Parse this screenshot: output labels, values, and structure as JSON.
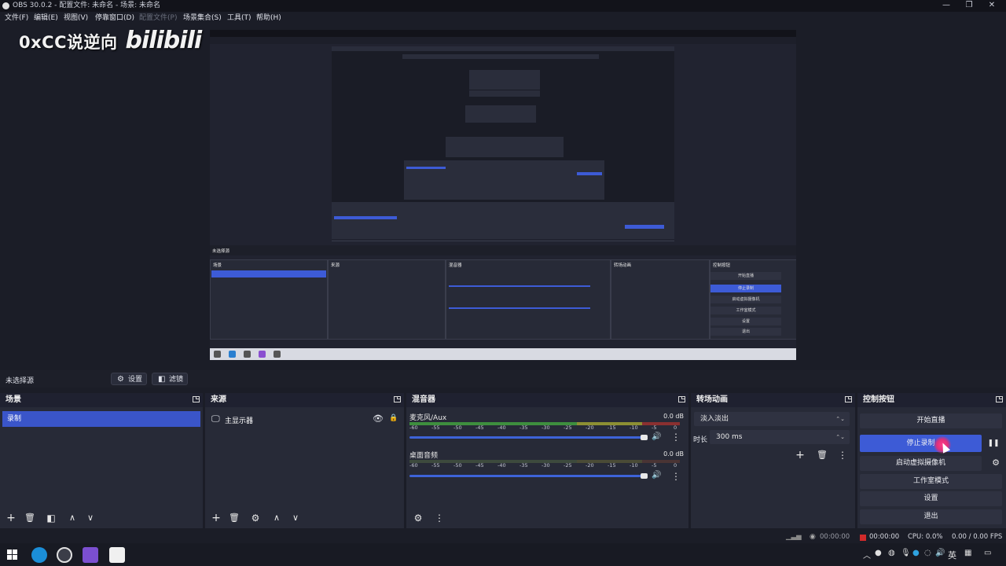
{
  "window": {
    "title": "OBS 30.0.2 - 配置文件: 未命名 - 场景: 未命名",
    "minimize_glyph": "—",
    "maximize_glyph": "❐",
    "close_glyph": "✕"
  },
  "menu": [
    "文件(F)",
    "编辑(E)",
    "视图(V)",
    "停靠窗口(D)",
    "配置文件(P)",
    "场景集合(S)",
    "工具(T)",
    "帮助(H)"
  ],
  "watermark": {
    "text": "0xCC说逆向",
    "logo": "bilibili"
  },
  "source_bar": {
    "no_source": "未选择源",
    "properties": "设置",
    "filters": "滤镜"
  },
  "scenes": {
    "title": "场景",
    "items": [
      "录制"
    ],
    "selected_index": 0
  },
  "sources": {
    "title": "来源",
    "items": [
      {
        "name": "主显示器",
        "visible": true,
        "locked": true
      }
    ]
  },
  "mixer": {
    "title": "混音器",
    "tick_labels": [
      "-60",
      "-55",
      "-50",
      "-45",
      "-40",
      "-35",
      "-30",
      "-25",
      "-20",
      "-15",
      "-10",
      "-5",
      "0"
    ],
    "channels": [
      {
        "name": "麦克风/Aux",
        "db": "0.0 dB",
        "muted": false,
        "volume_fraction": 0.97
      },
      {
        "name": "桌面音频",
        "db": "0.0 dB",
        "muted": true,
        "volume_fraction": 0.97
      }
    ]
  },
  "transitions": {
    "title": "转场动画",
    "type": "淡入淡出",
    "duration_label": "时长",
    "duration": "300 ms"
  },
  "controls": {
    "title": "控制按钮",
    "start_stream": "开始直播",
    "stop_record": "停止录制",
    "virtual_cam": "启动虚拟摄像机",
    "studio_mode": "工作室模式",
    "settings": "设置",
    "exit": "退出"
  },
  "status": {
    "stream_time": "00:00:00",
    "rec_time": "00:00:00",
    "cpu": "CPU: 0.0%",
    "fps": "0.00 / 0.00 FPS"
  },
  "taskbar": {
    "ime": "英"
  },
  "colors": {
    "accent": "#3d5bd6",
    "record": "#d12a2a",
    "bg": "#1b1d27",
    "panel": "#272a37"
  },
  "icons": {
    "gear": "⚙",
    "plus": "+",
    "trash": "🗑",
    "filter": "◧",
    "up": "∧",
    "down": "∨",
    "eye": "👁",
    "lock": "🔒",
    "speaker": "🔊",
    "kebab": "⋮",
    "pause": "❚❚",
    "monitor": "🖵",
    "chevron_updown": "⌃⌄"
  }
}
